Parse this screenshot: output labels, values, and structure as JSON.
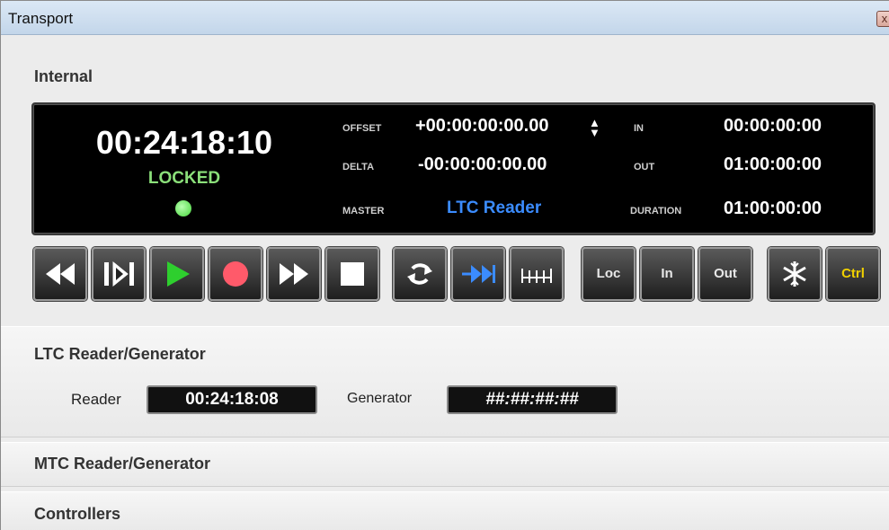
{
  "window": {
    "title": "Transport",
    "close_label": "x"
  },
  "internal": {
    "title": "Internal",
    "timecode": "00:24:18:10",
    "status": "LOCKED",
    "offset_label": "OFFSET",
    "offset_value": "+00:00:00:00.00",
    "delta_label": "DELTA",
    "delta_value": "-00:00:00:00.00",
    "master_label": "MASTER",
    "master_value": "LTC Reader",
    "in_label": "IN",
    "in_value": "00:00:00:00",
    "out_label": "OUT",
    "out_value": "01:00:00:00",
    "duration_label": "DURATION",
    "duration_value": "01:00:00:00",
    "spinner_up": "▲",
    "spinner_down": "▼"
  },
  "transport_buttons": {
    "loc_label": "Loc",
    "in_label": "In",
    "out_label": "Out",
    "ctrl_label": "Ctrl"
  },
  "ltc": {
    "title": "LTC Reader/Generator",
    "reader_label": "Reader",
    "reader_value": "00:24:18:08",
    "generator_label": "Generator",
    "generator_value": "##:##:##:##"
  },
  "mtc": {
    "title": "MTC Reader/Generator"
  },
  "controllers": {
    "title": "Controllers"
  },
  "colors": {
    "locked_green": "#8be07a",
    "play_green": "#2ecf2e",
    "record_red": "#ff5a6a",
    "master_blue": "#3b8cff",
    "ctrl_yellow": "#f0d000"
  }
}
